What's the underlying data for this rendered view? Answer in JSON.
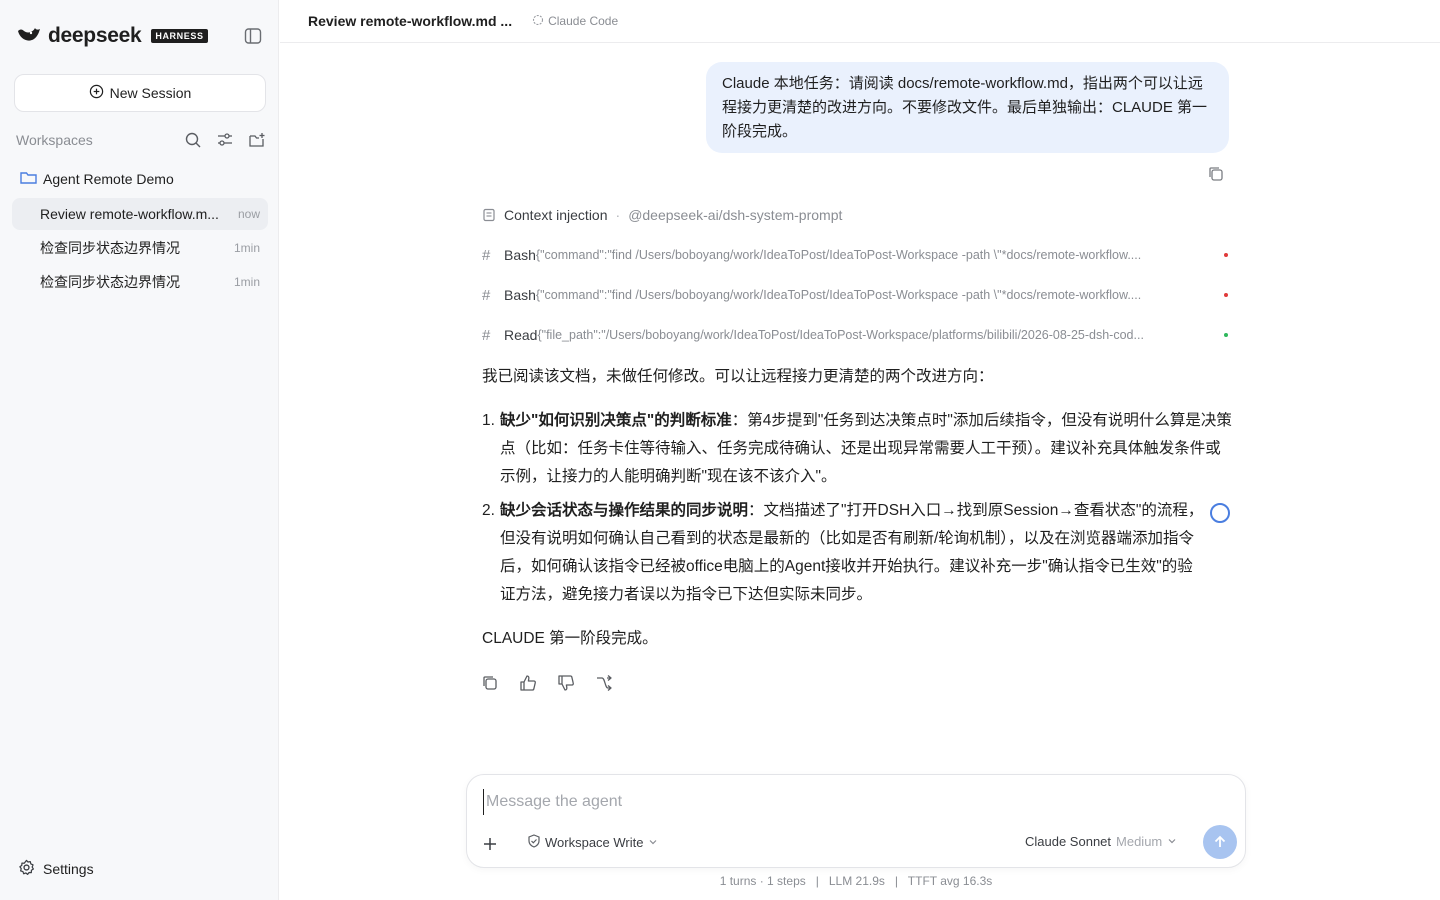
{
  "sidebar": {
    "brand_name": "deepseek",
    "brand_badge": "HARNESS",
    "new_session_label": "New Session",
    "workspaces_label": "Workspaces",
    "workspace_name": "Agent Remote Demo",
    "sessions": [
      {
        "title": "Review remote-workflow.m...",
        "time": "now"
      },
      {
        "title": "检查同步状态边界情况",
        "time": "1min"
      },
      {
        "title": "检查同步状态边界情况",
        "time": "1min"
      }
    ],
    "settings_label": "Settings"
  },
  "topbar": {
    "title": "Review remote-workflow.md ...",
    "agent": "Claude Code"
  },
  "user_message": "Claude 本地任务：请阅读 docs/remote-workflow.md，指出两个可以让远程接力更清楚的改进方向。不要修改文件。最后单独输出：CLAUDE 第一阶段完成。",
  "context": {
    "label": "Context injection",
    "source": "@deepseek-ai/dsh-system-prompt"
  },
  "tools": [
    {
      "name": "Bash",
      "args": "{\"command\":\"find /Users/boboyang/work/IdeaToPost/IdeaToPost-Workspace -path \\\"*docs/remote-workflow....",
      "status_color": "#e03a3a"
    },
    {
      "name": "Bash",
      "args": "{\"command\":\"find /Users/boboyang/work/IdeaToPost/IdeaToPost-Workspace -path \\\"*docs/remote-workflow....",
      "status_color": "#e03a3a"
    },
    {
      "name": "Read",
      "args": "{\"file_path\":\"/Users/boboyang/work/IdeaToPost/IdeaToPost-Workspace/platforms/bilibili/2026-08-25-dsh-cod...",
      "status_color": "#2eb85c"
    }
  ],
  "answer": {
    "intro": "我已阅读该文档，未做任何修改。可以让远程接力更清楚的两个改进方向：",
    "items": [
      {
        "num": "1.",
        "bold": "缺少\"如何识别决策点\"的判断标准",
        "text": "：第4步提到\"任务到达决策点时\"添加后续指令，但没有说明什么算是决策点（比如：任务卡住等待输入、任务完成待确认、还是出现异常需要人工干预）。建议补充具体触发条件或示例，让接力的人能明确判断\"现在该不该介入\"。"
      },
      {
        "num": "2.",
        "bold": "缺少会话状态与操作结果的同步说明",
        "text": "：文档描述了\"打开DSH入口→找到原Session→查看状态\"的流程，但没有说明如何确认自己看到的状态是最新的（比如是否有刷新/轮询机制），以及在浏览器端添加指令后，如何确认该指令已经被office电脑上的Agent接收并开始执行。建议补充一步\"确认指令已生效\"的验证方法，避免接力者误以为指令已下达但实际未同步。"
      }
    ],
    "closing": "CLAUDE 第一阶段完成。"
  },
  "composer": {
    "placeholder": "Message the agent",
    "permission": "Workspace Write",
    "model": "Claude Sonnet",
    "model_level": "Medium"
  },
  "stats": "1 turns · 1 steps   |   LLM 21.9s   |   TTFT avg 16.3s",
  "colors": {
    "accent": "#a8c4f0",
    "bubble": "#eaf1fd",
    "sidebar": "#f7f8fa"
  }
}
